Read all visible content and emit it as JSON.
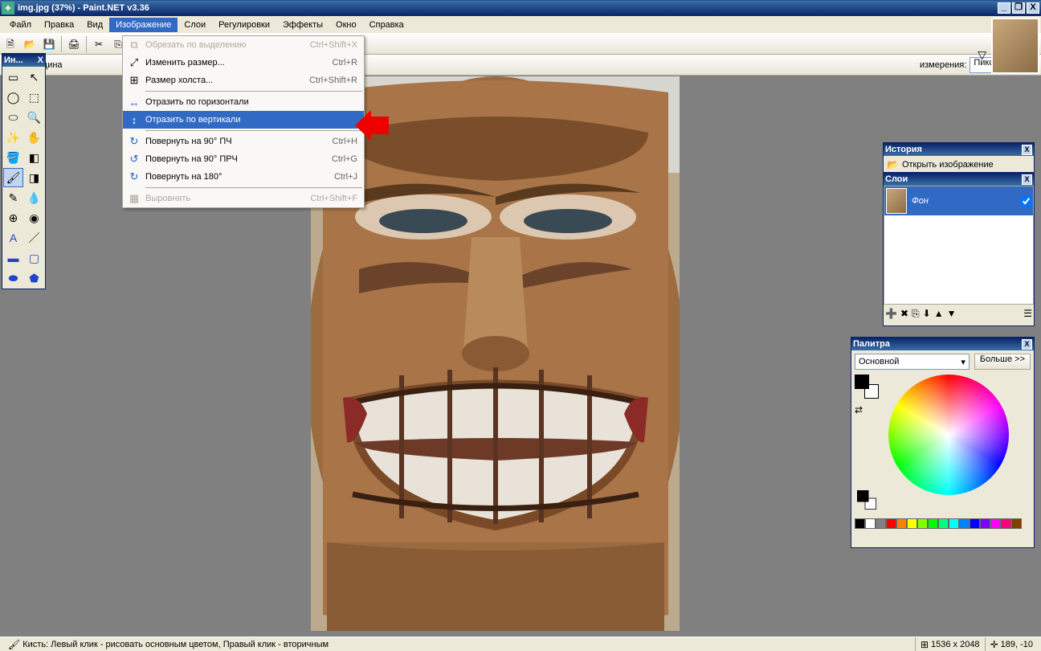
{
  "title": "img.jpg (37%) - Paint.NET v3.36",
  "win_buttons": {
    "min": "_",
    "max": "❐",
    "close": "X"
  },
  "menus": [
    "Файл",
    "Правка",
    "Вид",
    "Изображение",
    "Слои",
    "Регулировки",
    "Эффекты",
    "Окно",
    "Справка"
  ],
  "menu_open_index": 3,
  "dropdown": [
    {
      "icon": "✂",
      "label": "Обрезать по выделению",
      "shortcut": "Ctrl+Shift+X",
      "disabled": true
    },
    {
      "icon": "↔",
      "label": "Изменить размер...",
      "shortcut": "Ctrl+R"
    },
    {
      "icon": "⊞",
      "label": "Размер холста...",
      "shortcut": "Ctrl+Shift+R"
    },
    {
      "sep": true
    },
    {
      "icon": "↔",
      "label": "Отразить по горизонтали",
      "shortcut": ""
    },
    {
      "icon": "↕",
      "label": "Отразить по вертикали",
      "shortcut": "",
      "highlight": true
    },
    {
      "sep": true
    },
    {
      "icon": "↻",
      "label": "Повернуть на 90° ПЧ",
      "shortcut": "Ctrl+H"
    },
    {
      "icon": "↺",
      "label": "Повернуть на 90° ПРЧ",
      "shortcut": "Ctrl+G"
    },
    {
      "icon": "↻",
      "label": "Повернуть на 180°",
      "shortcut": "Ctrl+J"
    },
    {
      "sep": true
    },
    {
      "icon": "▦",
      "label": "Выровнять",
      "shortcut": "Ctrl+Shift+F",
      "disabled": true
    }
  ],
  "optionbar": {
    "thickness_label": "Толщина",
    "measure_label": "измерения:",
    "measure_value": "Пиксел"
  },
  "toolspanel": {
    "title": "Ин...",
    "close": "X"
  },
  "history": {
    "title": "История",
    "item": "Открыть изображение"
  },
  "layers": {
    "title": "Слои",
    "item": "Фон"
  },
  "palette": {
    "title": "Палитра",
    "select": "Основной",
    "more": "Больше >>"
  },
  "palette_colors": [
    "#000000",
    "#ffffff",
    "#808080",
    "#ff0000",
    "#ff8000",
    "#ffff00",
    "#80ff00",
    "#00ff00",
    "#00ff80",
    "#00ffff",
    "#0080ff",
    "#0000ff",
    "#8000ff",
    "#ff00ff",
    "#ff0080",
    "#804000"
  ],
  "status": {
    "hint": "Кисть: Левый клик - рисовать основным цветом, Правый клик - вторичным",
    "size": "1536 x 2048",
    "pos": "189, -10"
  }
}
